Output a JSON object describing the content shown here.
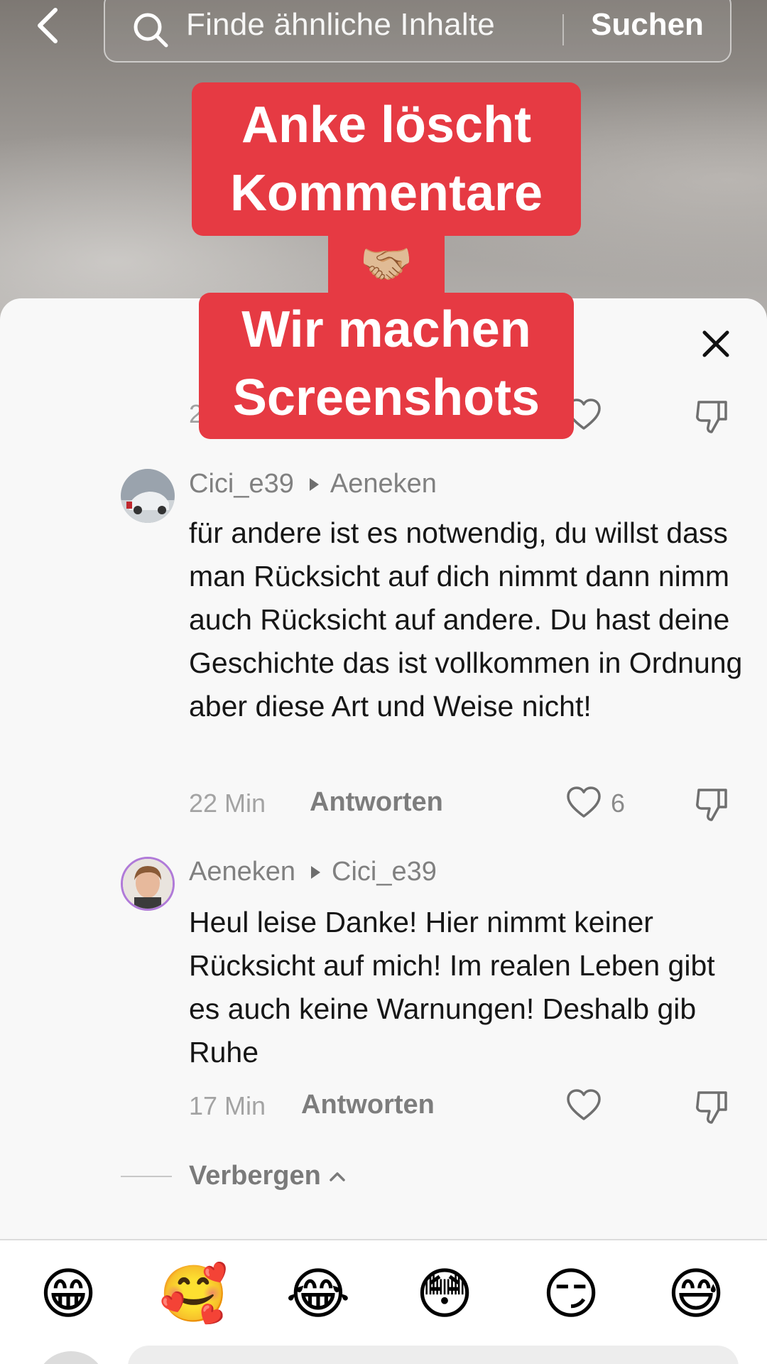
{
  "header": {
    "search_placeholder": "Finde ähnliche Inhalte",
    "search_button": "Suchen"
  },
  "overlay": {
    "top_line1": "Anke löscht",
    "top_line2": "Kommentare",
    "emoji": "🤝🏼",
    "bottom_line1": "Wir machen",
    "bottom_line2": "Screenshots",
    "banner_color": "#e63a43"
  },
  "partial_comment": {
    "time_fragment": "2"
  },
  "comments": [
    {
      "author": "Cici_e39",
      "reply_to": "Aeneken",
      "text": "für andere ist es notwendig, du willst dass man Rücksicht auf dich nimmt dann nimm auch Rücksicht auf andere. Du hast deine Geschichte das ist vollkommen in Ordnung aber diese Art und Weise nicht!",
      "time": "22 Min",
      "reply_label": "Antworten",
      "likes": "6"
    },
    {
      "author": "Aeneken",
      "reply_to": "Cici_e39",
      "text": "Heul leise Danke! Hier nimmt keiner Rücksicht auf mich! Im realen Leben gibt es auch keine Warnungen! Deshalb gib Ruhe",
      "time": "17 Min",
      "reply_label": "Antworten",
      "likes": ""
    }
  ],
  "hide_label": "Verbergen",
  "emojis": [
    "😁",
    "🥰",
    "😂",
    "😳",
    "😏",
    "😅"
  ],
  "icons": {
    "back": "chevron-left-icon",
    "search": "search-icon",
    "close": "close-icon",
    "like": "heart-icon",
    "dislike": "thumbs-down-icon",
    "hide": "chevron-up-icon"
  }
}
